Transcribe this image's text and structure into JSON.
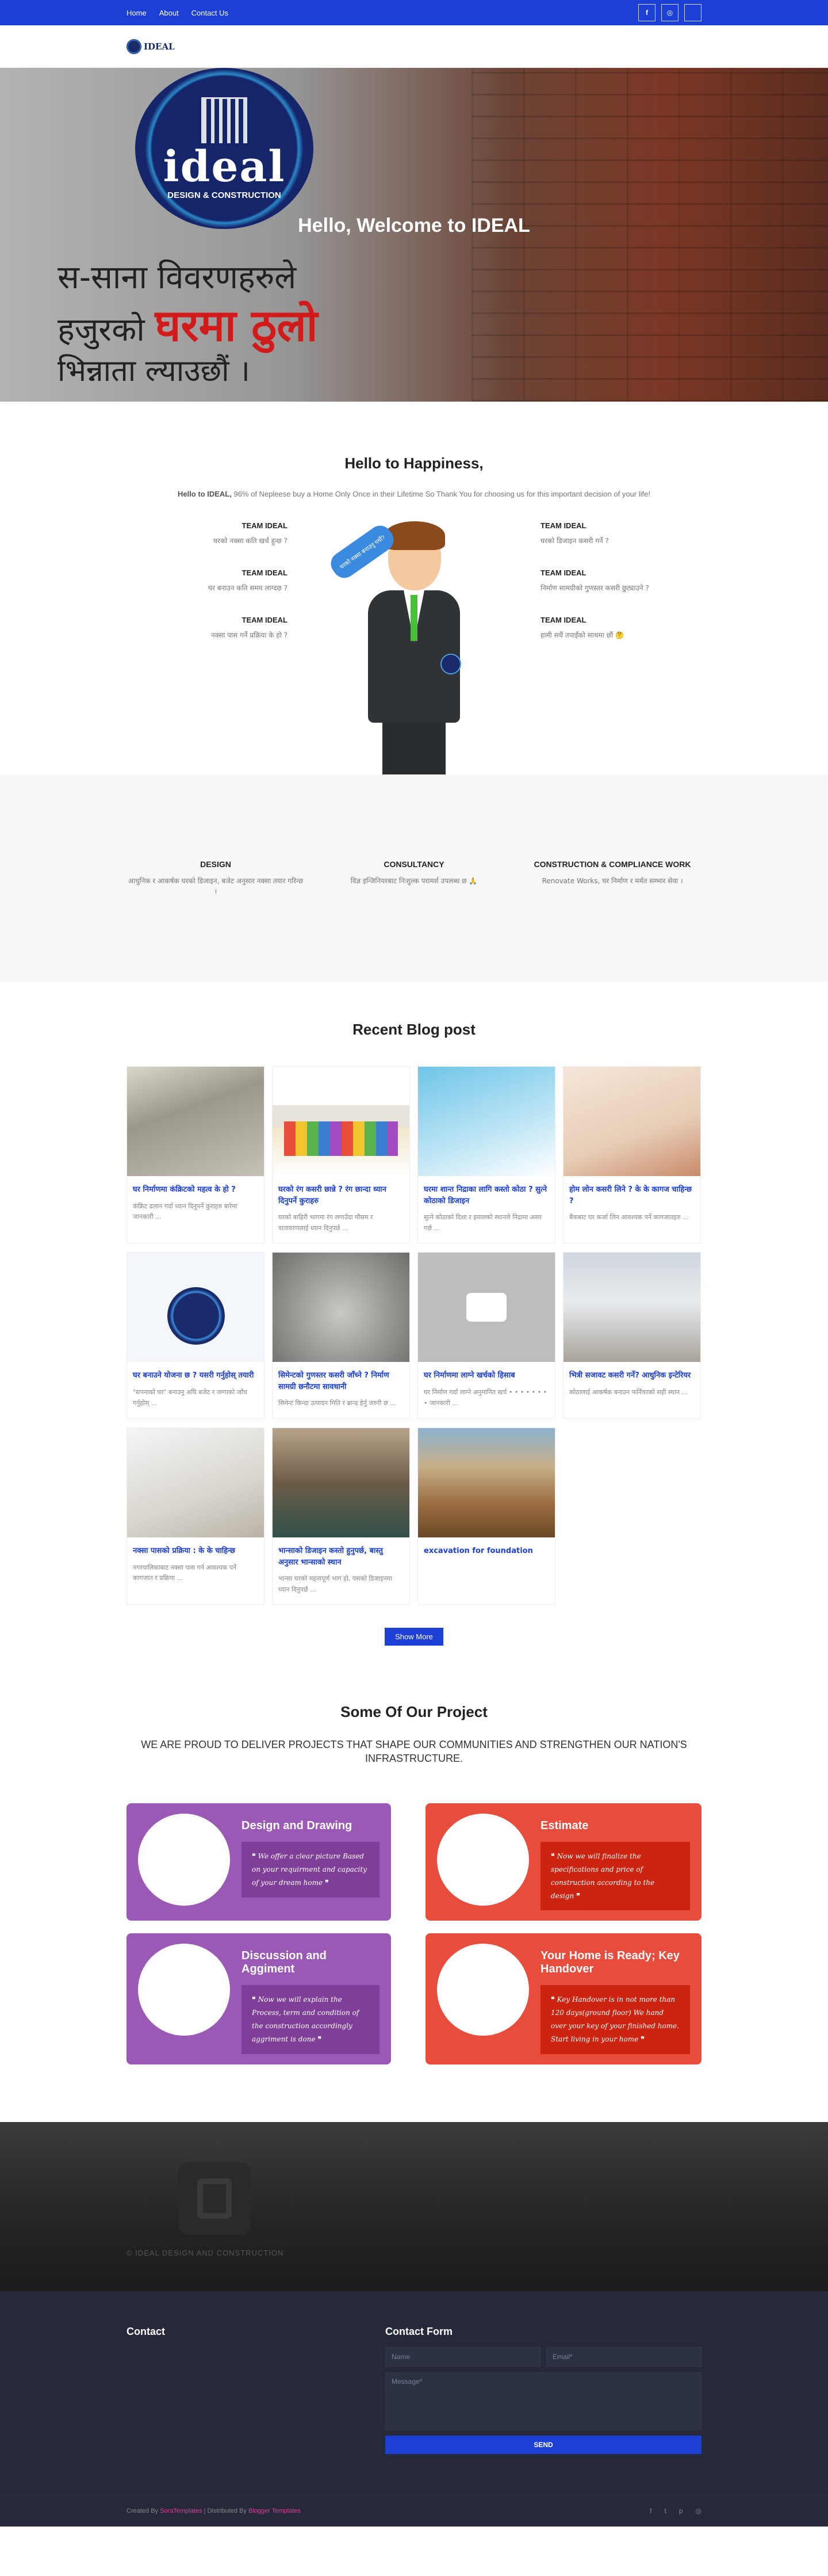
{
  "topbar": {
    "nav": [
      "Home",
      "About",
      "Contact Us"
    ],
    "social": [
      {
        "icon": "facebook-icon",
        "glyph": "f"
      },
      {
        "icon": "instagram-icon",
        "glyph": "◎"
      },
      {
        "icon": "blank-icon",
        "glyph": ""
      }
    ]
  },
  "header": {
    "logo_text": "IDEAL"
  },
  "hero": {
    "logo_word": "ideal",
    "logo_sub": "DESIGN & CONSTRUCTION",
    "title": "Hello, Welcome to IDEAL",
    "nepali_line1": "स-साना विवरणहरुले",
    "nepali_line2_a": "हजुरको ",
    "nepali_line2_b": "घरमा ठुलो",
    "nepali_line3": "भिन्नाता ल्याउछौं ।"
  },
  "happy": {
    "title": "Hello to Happiness,",
    "sub_bold": "Hello to IDEAL,",
    "sub_text": " 96% of Nepleese buy a Home Only Once in their Lifetime So Thank You for choosing us for this important decision of your life!",
    "badge": "घरको नक्सा बनाउनु पर्यो?",
    "left": [
      {
        "title": "TEAM IDEAL",
        "text": "घरको नक्सा कति खर्च हुन्छ ?"
      },
      {
        "title": "TEAM IDEAL",
        "text": "घर बनाउन कति समय लाग्दछ ?"
      },
      {
        "title": "TEAM IDEAL",
        "text": "नक्सा पास गर्ने प्रक्रिया के हो ?"
      }
    ],
    "right": [
      {
        "title": "TEAM IDEAL",
        "text": "घरको डिजाइन कसरी गर्ने ?"
      },
      {
        "title": "TEAM IDEAL",
        "text": "निर्माण सामग्रीको गुणस्तर कसरी छुट्याउने ?"
      },
      {
        "title": "TEAM IDEAL",
        "text": "हामी सधैं तपाईंको साथमा छौं 🤔"
      }
    ]
  },
  "services": [
    {
      "title": "DESIGN",
      "text": "आधुनिक र आकर्षक घरको डिजाइन, बजेट अनुसार नक्सा तयार गरिन्छ ।"
    },
    {
      "title": "CONSULTANCY",
      "text": "विज्ञ इन्जिनियरबाट निःशुल्क परामर्श उपलब्ध छ 🙏"
    },
    {
      "title": "CONSTRUCTION & COMPLIANCE WORK",
      "text": "Renovate Works, घर निर्माण र मर्मत सम्भार सेवा ।"
    }
  ],
  "blog": {
    "title": "Recent Blog post",
    "show_more": "Show More",
    "posts": [
      {
        "img": "concrete",
        "title": "घर निर्माणमा कंक्रिटको महत्व के हो ?",
        "excerpt": "कंक्रिट ढलान गर्दा ध्यान दिनुपर्ने कुराहरु बारेमा जानकारी ..."
      },
      {
        "img": "paint",
        "title": "घरको रंग कसरी छान्ने ? रंग छान्दा ध्यान दिनुपर्ने कुराहरु",
        "excerpt": "घरको बाहिरी भागमा रंग लगाउँदा मौसम र वातावरणलाई ध्यान दिनुपर्छ ..."
      },
      {
        "img": "sleep",
        "title": "घरमा शान्त निद्राका लागि कस्तो कोठा ? सुत्ने कोठाको डिजाइन",
        "excerpt": "सुत्ने कोठाको दिशा र झ्यालको स्थानले निद्रामा असर गर्छ ..."
      },
      {
        "img": "loan",
        "title": "होम लोन कसरी लिने ? के के कागज चाहिन्छ ?",
        "excerpt": "बैंकबाट घर कर्जा लिन आवश्यक पर्ने कागजातहरु ..."
      },
      {
        "img": "ideal",
        "title": "घर बनाउने योजना छ ? यसरी गर्नुहोस् तयारी",
        "excerpt": "\"सपनाको घर\" बनाउनु अघि बजेट र जग्गाको जाँच गर्नुहोस् ..."
      },
      {
        "img": "cement",
        "title": "सिमेन्टको गुणस्तर कसरी जाँच्ने ? निर्माण सामग्री छनौटमा सावधानी",
        "excerpt": "सिमेन्ट किन्दा उत्पादन मिति र ब्रान्ड हेर्नु जरुरी छ ..."
      },
      {
        "img": "placeholder",
        "title": "घर निर्माणमा लाग्ने खर्चको हिसाब",
        "excerpt": "घर निर्माण गर्दा लाग्ने अनुमानित खर्च • • • • • • • • जानकारी ..."
      },
      {
        "img": "room",
        "title": "भित्री सजावट कसरी गर्ने? आधुनिक इन्टेरियर",
        "excerpt": "कोठालाई आकर्षक बनाउन फर्निचरको सही स्थान ..."
      },
      {
        "img": "plan",
        "title": "नक्सा पासको प्रक्रिया : के के चाहिन्छ",
        "excerpt": "नगरपालिकाबाट नक्सा पास गर्न आवश्यक पर्ने कागजात र प्रक्रिया ..."
      },
      {
        "img": "kitchen",
        "title": "भान्साको डिजाइन कस्तो हुनुपर्छ, बास्तु अनुसार भान्साको स्थान",
        "excerpt": "भान्सा घरको महत्वपूर्ण भाग हो, यसको डिजाइनमा ध्यान दिनुपर्छ ..."
      },
      {
        "img": "dirt",
        "title": "excavation for foundation",
        "excerpt": ""
      }
    ]
  },
  "projects": {
    "title": "Some Of Our Project",
    "sub": "WE ARE PROUD TO DELIVER PROJECTS THAT SHAPE OUR COMMUNITIES AND STRENGTHEN OUR NATION'S INFRASTRUCTURE.",
    "items": [
      {
        "color": "purple",
        "title": "Design and Drawing",
        "quote": "We offer a clear picture Based on your requirment and capacity of your dream home"
      },
      {
        "color": "red",
        "title": "Estimate",
        "quote": "Now we will finalize the specifications and price of construction according to the design"
      },
      {
        "color": "purple",
        "title": "Discussion and Aggiment",
        "quote": "Now we will explain the Process, term and condition of the construction accordingly aggriment is done"
      },
      {
        "color": "red",
        "title": "Your Home is Ready; Key Handover",
        "quote": "Key Handover is in not more than 120 days(ground floor) We hand over your key of your finished home. Start living in your home"
      }
    ]
  },
  "footer": {
    "copyright": "© IDEAL DESIGN AND CONSTRUCTION",
    "contact_title": "Contact",
    "form_title": "Contact Form",
    "name_ph": "Name",
    "email_ph": "Email*",
    "message_ph": "Message*",
    "send": "SEND",
    "created_by": "Created By ",
    "created_name": "SoraTemplates",
    "distributed_by": " | Distributed By ",
    "distributed_name": "Blogger Templates",
    "social": [
      "f",
      "t",
      "p",
      "◎"
    ]
  }
}
